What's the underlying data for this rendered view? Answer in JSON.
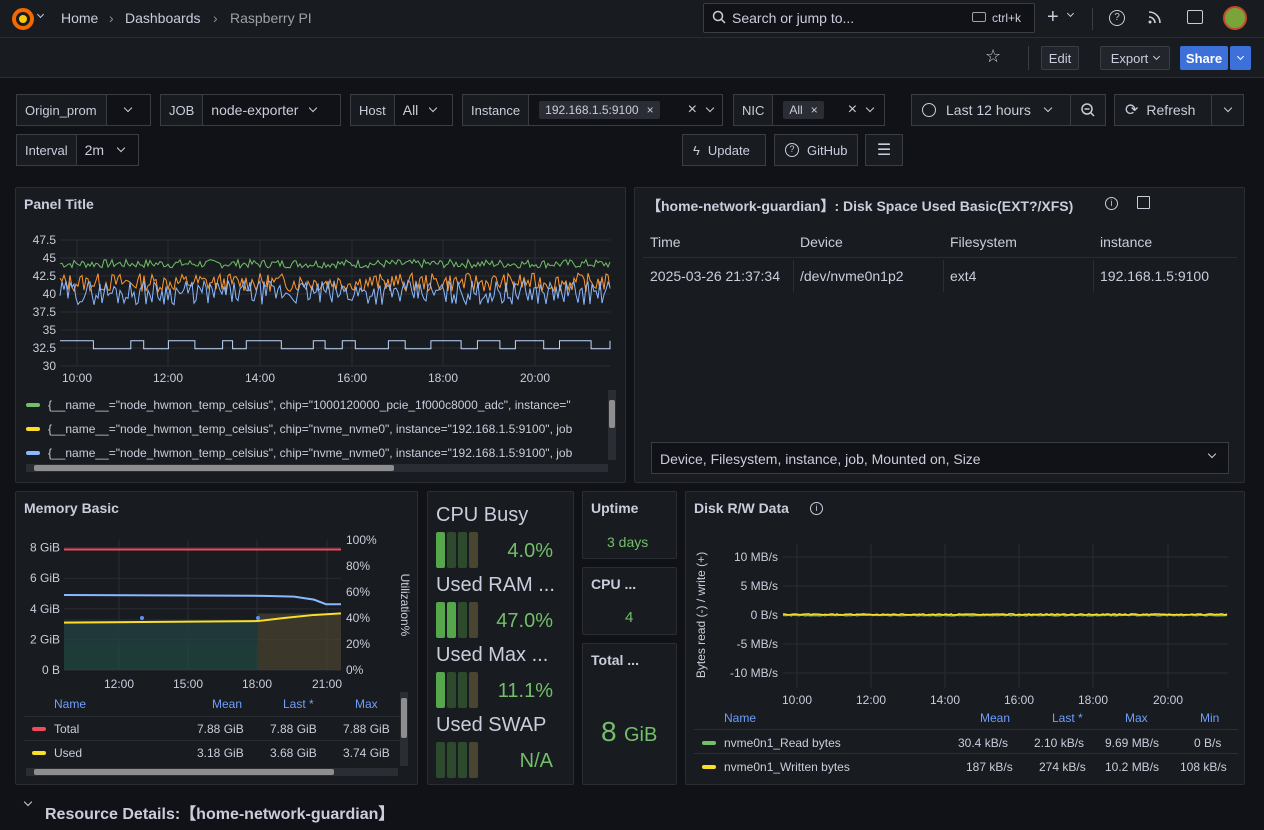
{
  "nav": {
    "breadcrumb": [
      "Home",
      "Dashboards",
      "Raspberry PI"
    ],
    "search_placeholder": "Search or jump to...",
    "search_shortcut": "ctrl+k"
  },
  "toolbar": {
    "edit": "Edit",
    "export": "Export",
    "share": "Share"
  },
  "vars": {
    "datasource": "Origin_prom",
    "job_label": "JOB",
    "job_value": "node-exporter",
    "host_label": "Host",
    "host_value": "All",
    "instance_label": "Instance",
    "instance_value": "192.168.1.5:9100",
    "nic_label": "NIC",
    "nic_value": "All",
    "interval_label": "Interval",
    "interval_value": "2m"
  },
  "time": {
    "range": "Last 12 hours",
    "refresh": "Refresh"
  },
  "links": {
    "update": "Update",
    "github": "GitHub"
  },
  "temp_panel": {
    "title": "Panel Title",
    "y_ticks": [
      "47.5",
      "45",
      "42.5",
      "40",
      "37.5",
      "35",
      "32.5",
      "30"
    ],
    "x_ticks": [
      "10:00",
      "12:00",
      "14:00",
      "16:00",
      "18:00",
      "20:00"
    ],
    "legend": [
      {
        "text": "{__name__=\"node_hwmon_temp_celsius\", chip=\"1000120000_pcie_1f000c8000_adc\", instance=\"",
        "color": "#73bf69"
      },
      {
        "text": "{__name__=\"node_hwmon_temp_celsius\", chip=\"nvme_nvme0\", instance=\"192.168.1.5:9100\", job",
        "color": "#fade2a"
      },
      {
        "text": "{__name__=\"node_hwmon_temp_celsius\", chip=\"nvme_nvme0\", instance=\"192.168.1.5:9100\", job",
        "color": "#8ab8ff"
      }
    ]
  },
  "disk_panel": {
    "title": "【home-network-guardian】: Disk Space Used Basic(EXT?/XFS)",
    "columns": [
      "Time",
      "Device",
      "Filesystem",
      "instance"
    ],
    "row": [
      "2025-03-26 21:37:34",
      "/dev/nvme0n1p2",
      "ext4",
      "192.168.1.5:9100"
    ],
    "select": "Device, Filesystem, instance, job, Mounted on, Size"
  },
  "mem_panel": {
    "title": "Memory Basic",
    "y_left": [
      "8 GiB",
      "6 GiB",
      "4 GiB",
      "2 GiB",
      "0 B"
    ],
    "y_right": [
      "100%",
      "80%",
      "60%",
      "40%",
      "20%",
      "0%"
    ],
    "y_right_label": "Utilization%",
    "x_ticks": [
      "12:00",
      "15:00",
      "18:00",
      "21:00"
    ],
    "legend_headers": [
      "Name",
      "Mean",
      "Last *",
      "Max"
    ],
    "legend_rows": [
      {
        "name": "Total",
        "mean": "7.88 GiB",
        "last": "7.88 GiB",
        "max": "7.88 GiB",
        "color": "#f2495c"
      },
      {
        "name": "Used",
        "mean": "3.18 GiB",
        "last": "3.68 GiB",
        "max": "3.74 GiB",
        "color": "#fade2a"
      }
    ]
  },
  "gauges": [
    {
      "label": "CPU Busy",
      "value": "4.0%",
      "fill": 0.04
    },
    {
      "label": "Used RAM ...",
      "value": "47.0%",
      "fill": 0.47
    },
    {
      "label": "Used Max ...",
      "value": "11.1%",
      "fill": 0.111
    },
    {
      "label": "Used SWAP",
      "value": "N/A",
      "fill": 0
    }
  ],
  "stats": {
    "uptime_title": "Uptime",
    "uptime_value": "3 days",
    "cpu_title": "CPU ...",
    "cpu_value": "4",
    "total_title": "Total ...",
    "total_value": "8",
    "total_unit": "GiB"
  },
  "rw_panel": {
    "title": "Disk R/W Data",
    "y_ticks": [
      "10 MB/s",
      "5 MB/s",
      "0 B/s",
      "-5 MB/s",
      "-10 MB/s"
    ],
    "y_label": "Bytes read (-) / write (+)",
    "x_ticks": [
      "10:00",
      "12:00",
      "14:00",
      "16:00",
      "18:00",
      "20:00"
    ],
    "legend_headers": [
      "Name",
      "Mean",
      "Last *",
      "Max",
      "Min"
    ],
    "legend_rows": [
      {
        "name": "nvme0n1_Read bytes",
        "mean": "30.4 kB/s",
        "last": "2.10 kB/s",
        "max": "9.69 MB/s",
        "min": "0 B/s",
        "color": "#73bf69"
      },
      {
        "name": "nvme0n1_Written bytes",
        "mean": "187 kB/s",
        "last": "274 kB/s",
        "max": "10.2 MB/s",
        "min": "108 kB/s",
        "color": "#fade2a"
      }
    ]
  },
  "row_title": "Resource Details:【home-network-guardian】"
}
